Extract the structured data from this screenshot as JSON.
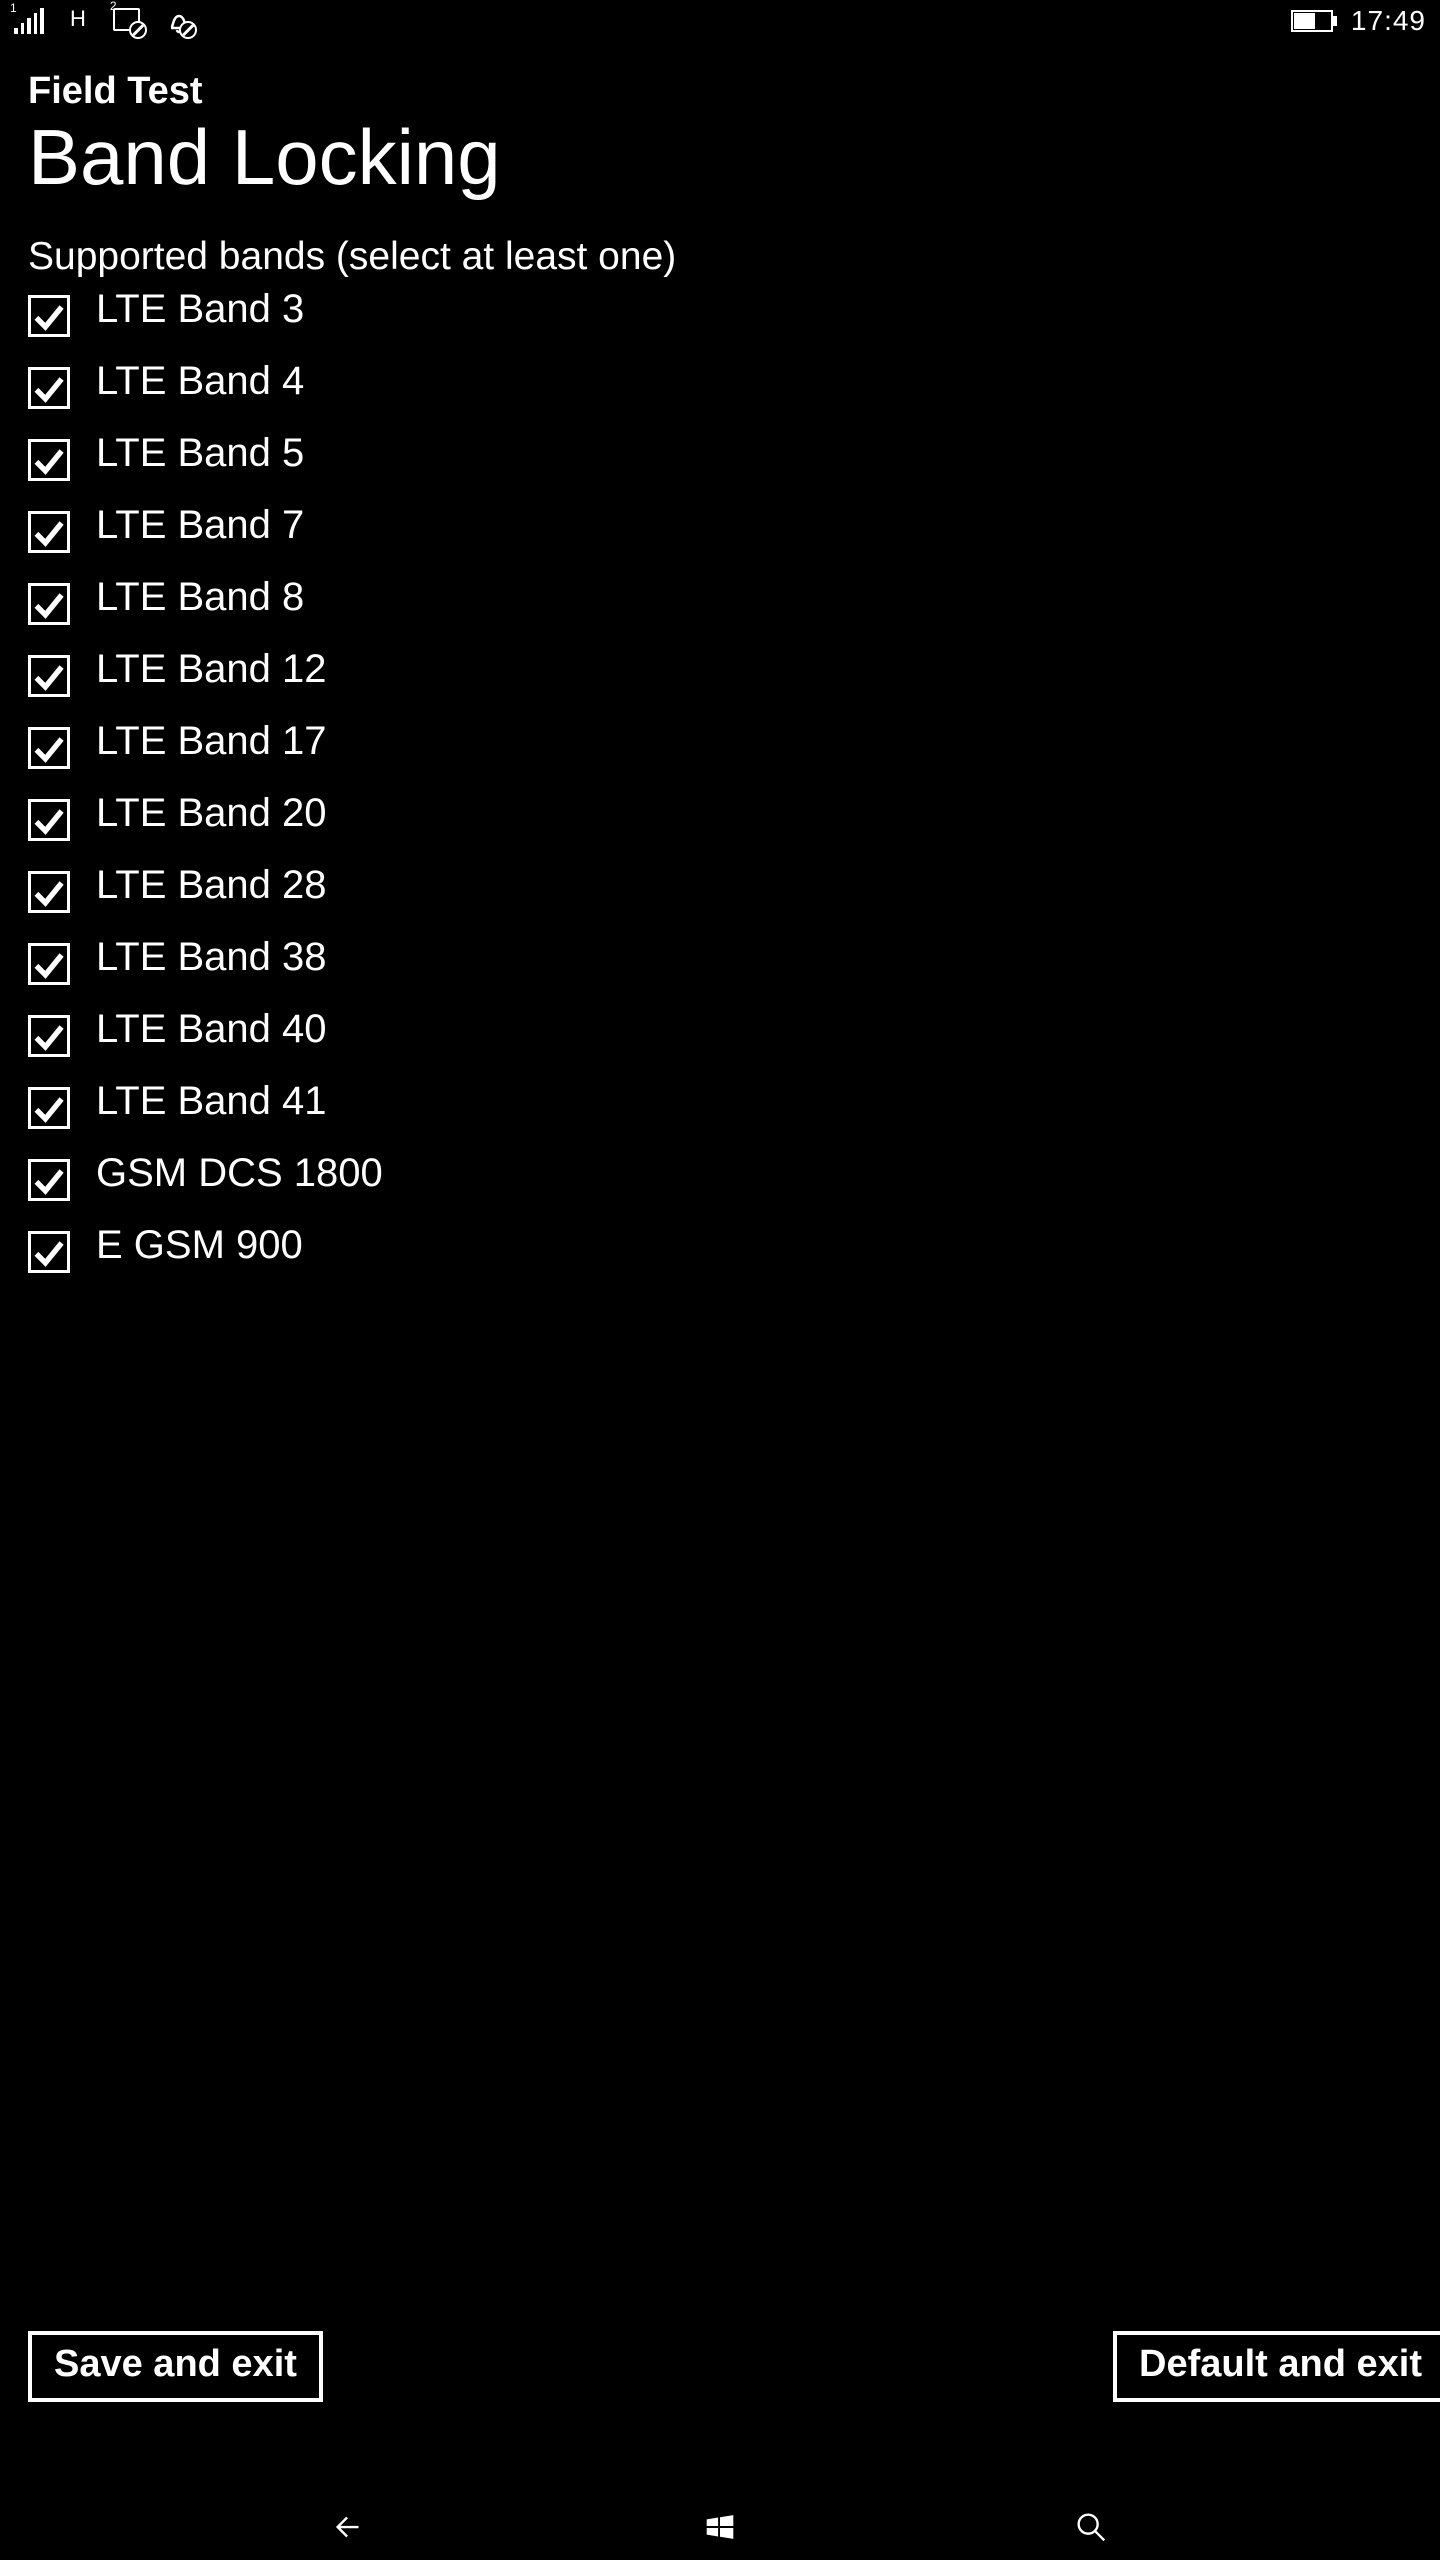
{
  "status": {
    "sim1_sup": "1",
    "network_letter": "H",
    "sim2_sup": "2",
    "time": "17:49"
  },
  "header": {
    "app_title": "Field Test",
    "page_title": "Band Locking"
  },
  "subheading": "Supported bands (select at least one)",
  "bands": [
    {
      "label": "LTE Band 3",
      "checked": true
    },
    {
      "label": "LTE Band 4",
      "checked": true
    },
    {
      "label": "LTE Band 5",
      "checked": true
    },
    {
      "label": "LTE Band 7",
      "checked": true
    },
    {
      "label": "LTE Band 8",
      "checked": true
    },
    {
      "label": "LTE Band 12",
      "checked": true
    },
    {
      "label": "LTE Band 17",
      "checked": true
    },
    {
      "label": "LTE Band 20",
      "checked": true
    },
    {
      "label": "LTE Band 28",
      "checked": true
    },
    {
      "label": "LTE Band 38",
      "checked": true
    },
    {
      "label": "LTE Band 40",
      "checked": true
    },
    {
      "label": "LTE Band 41",
      "checked": true
    },
    {
      "label": "GSM DCS 1800",
      "checked": true
    },
    {
      "label": "E GSM 900",
      "checked": true
    }
  ],
  "buttons": {
    "save": "Save and exit",
    "default": "Default and exit"
  }
}
